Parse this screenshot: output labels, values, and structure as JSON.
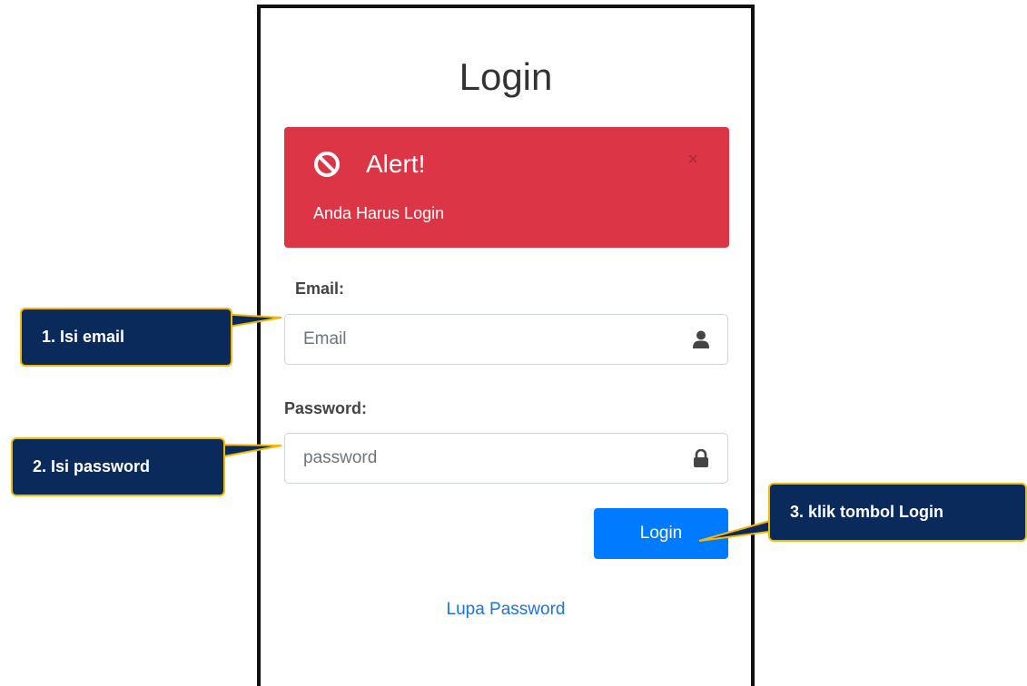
{
  "login": {
    "title": "Login",
    "alert": {
      "title": "Alert!",
      "message": "Anda Harus Login",
      "close_symbol": "×",
      "icon": "ban-icon",
      "color": "#dc3545"
    },
    "email": {
      "label": "Email:",
      "placeholder": "Email",
      "value": "",
      "icon": "user-icon"
    },
    "password": {
      "label": "Password:",
      "placeholder": "password",
      "value": "",
      "icon": "lock-icon"
    },
    "submit_label": "Login",
    "forgot_label": "Lupa Password",
    "primary_color": "#007bff"
  },
  "callouts": {
    "step1": "1. Isi email",
    "step2": "2. Isi password",
    "step3": "3. klik tombol Login",
    "fill_color": "#0b2a5c",
    "border_color": "#f5b800"
  }
}
